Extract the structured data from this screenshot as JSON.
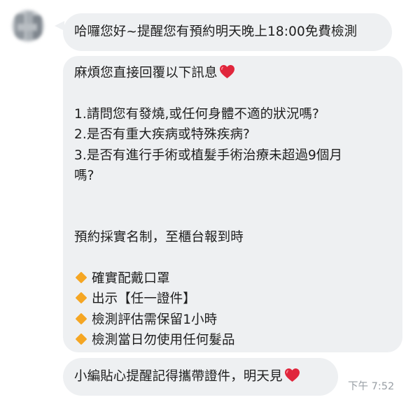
{
  "messages": [
    {
      "text": "哈囉您好~提醒您有預約明天晚上18:00免費檢測"
    },
    {
      "intro": "麻煩您直接回覆以下訊息",
      "questions": [
        "1.請問您有發燒,或任何身體不適的狀況嗎?",
        "2.是否有重大疾病或特殊疾病?",
        "3.是否有進行手術或植髮手術治療未超過9個月",
        "嗎?"
      ],
      "notice": "預約採實名制，至櫃台報到時",
      "items": [
        "確實配戴口罩",
        "出示【任一證件】",
        "檢測評估需保留1小時",
        "檢測當日勿使用任何髮品"
      ]
    },
    {
      "text": "小編貼心提醒記得攜帶證件，明天見"
    }
  ],
  "timestamp": "下午 7:52",
  "icons": {
    "heart": "red-heart-emoji",
    "bullet": "orange-diamond-emoji"
  },
  "colors": {
    "bubble": "#eef0f2",
    "text": "#1e1e1e",
    "timestamp": "#9aa0a6",
    "heart": "#e0263c",
    "diamond": "#f5a623"
  }
}
